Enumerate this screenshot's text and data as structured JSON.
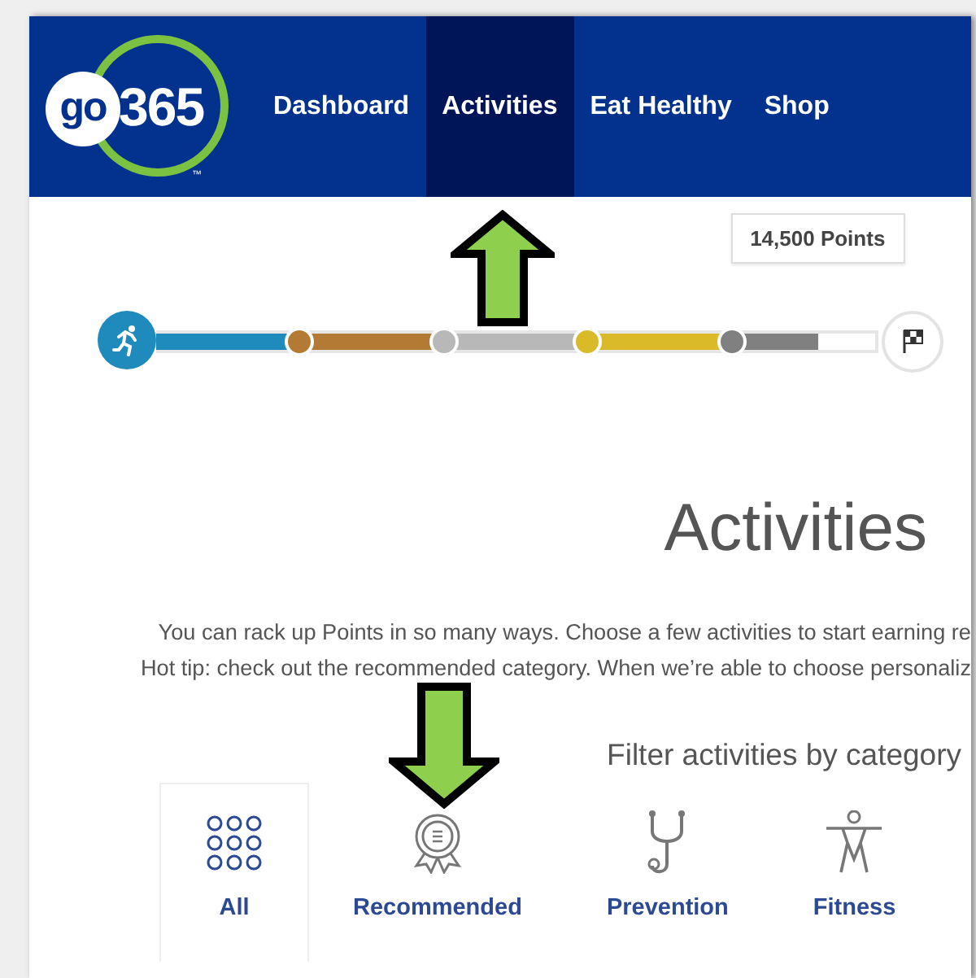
{
  "logo": {
    "prefix": "go",
    "number": "365",
    "mark": "™"
  },
  "nav": [
    {
      "label": "Dashboard",
      "selected": false
    },
    {
      "label": "Activities",
      "selected": true
    },
    {
      "label": "Eat Healthy",
      "selected": false
    },
    {
      "label": "Shop",
      "selected": false
    }
  ],
  "progress": {
    "points": "14,500 Points",
    "level": 0.92,
    "stages": [
      {
        "color": "#1f8bbd"
      },
      {
        "color": "#b27a35"
      },
      {
        "color": "#b8b8b8"
      },
      {
        "color": "#dbba2a"
      },
      {
        "color": "#808080"
      }
    ]
  },
  "heading": "Activities",
  "intro": [
    "You can rack up Points in so many ways. Choose a few activities to start earning re",
    "Hot tip: check out the recommended category. When we’re able to choose personaliz"
  ],
  "filter_label": "Filter activities by category",
  "categories": [
    {
      "kind": "all",
      "label": "All",
      "selected": true
    },
    {
      "kind": "recommended",
      "label": "Recommended",
      "selected": false
    },
    {
      "kind": "prevention",
      "label": "Prevention",
      "selected": false
    },
    {
      "kind": "fitness",
      "label": "Fitness",
      "selected": false
    }
  ]
}
